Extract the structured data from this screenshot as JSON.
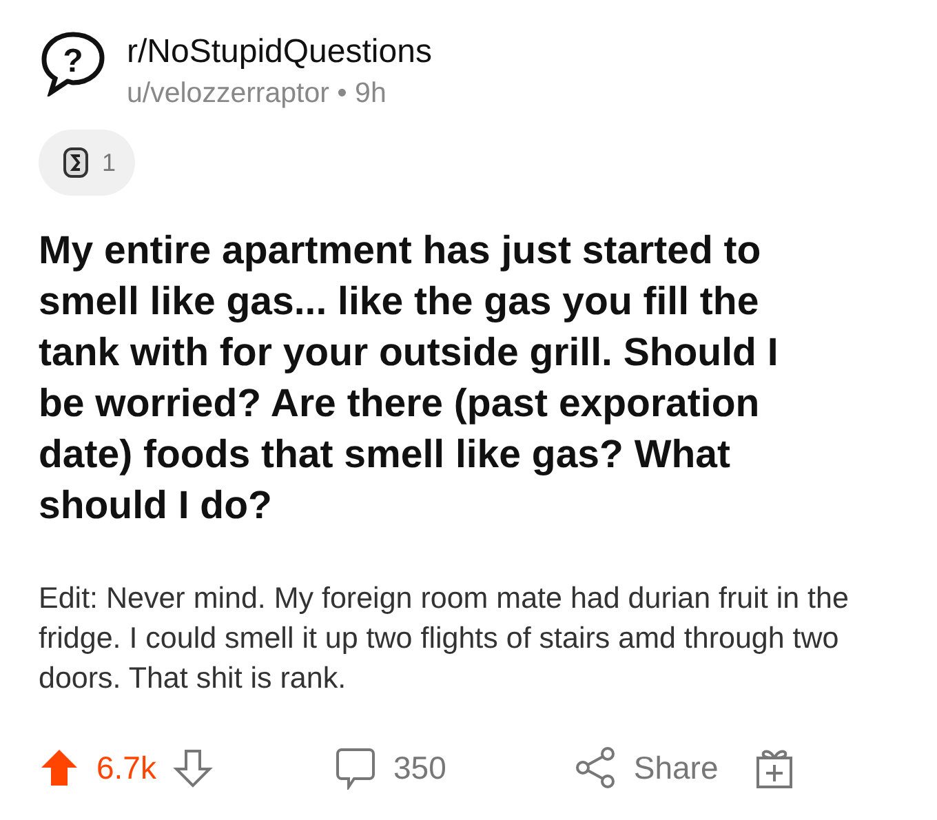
{
  "header": {
    "icon_glyph": "?",
    "subreddit": "r/NoStupidQuestions",
    "author": "u/velozzerraptor",
    "separator": "•",
    "age": "9h"
  },
  "award": {
    "count": "1"
  },
  "title": "My entire apartment has just started to smell like gas... like the gas you fill the tank with for your outside grill. Should I be worried? Are there (past exporation date) foods that smell like gas? What should I do?",
  "body": "Edit: Never mind. My foreign room mate had durian fruit in the fridge. I could smell it up two flights of stairs amd through two doors. That shit is rank.",
  "actions": {
    "upvoted": true,
    "score": "6.7k",
    "comments": "350",
    "share": "Share"
  }
}
